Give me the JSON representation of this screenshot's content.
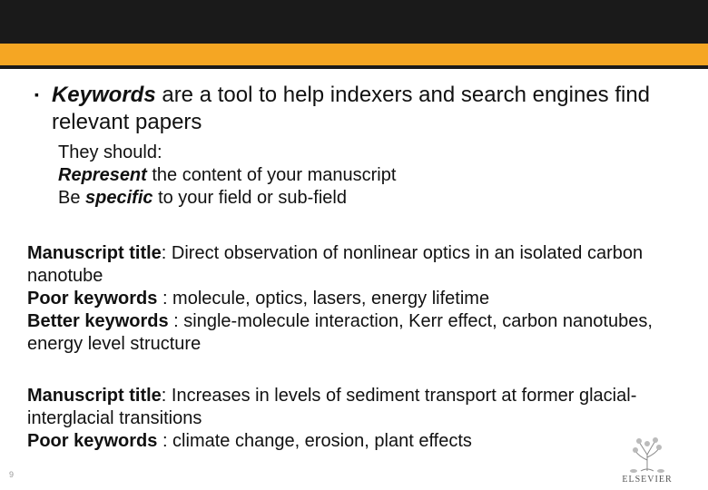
{
  "lead": {
    "bulleted_word": "Keywords",
    "rest": " are a tool to help indexers and search engines find relevant papers"
  },
  "sub": {
    "line1": "They should:",
    "line2_bold": "Represent",
    "line2_rest": " the content of your manuscript",
    "line3_pre": "Be ",
    "line3_bold": "specific",
    "line3_rest": " to your field or sub-field"
  },
  "example1": {
    "title_label": "Manuscript title",
    "title_value": ": Direct observation of nonlinear optics in an isolated carbon nanotube",
    "poor_label": "Poor keywords ",
    "poor_value": ": molecule, optics, lasers, energy lifetime",
    "better_label": "Better keywords   ",
    "better_value": ": single-molecule interaction, Kerr effect, carbon nanotubes, energy level structure"
  },
  "example2": {
    "title_label": "Manuscript title",
    "title_value": ": Increases in levels of sediment transport at former glacial-interglacial transitions",
    "poor_label": "Poor keywords ",
    "poor_value": ": climate change, erosion, plant effects"
  },
  "page_number": "9",
  "publisher": "ELSEVIER"
}
